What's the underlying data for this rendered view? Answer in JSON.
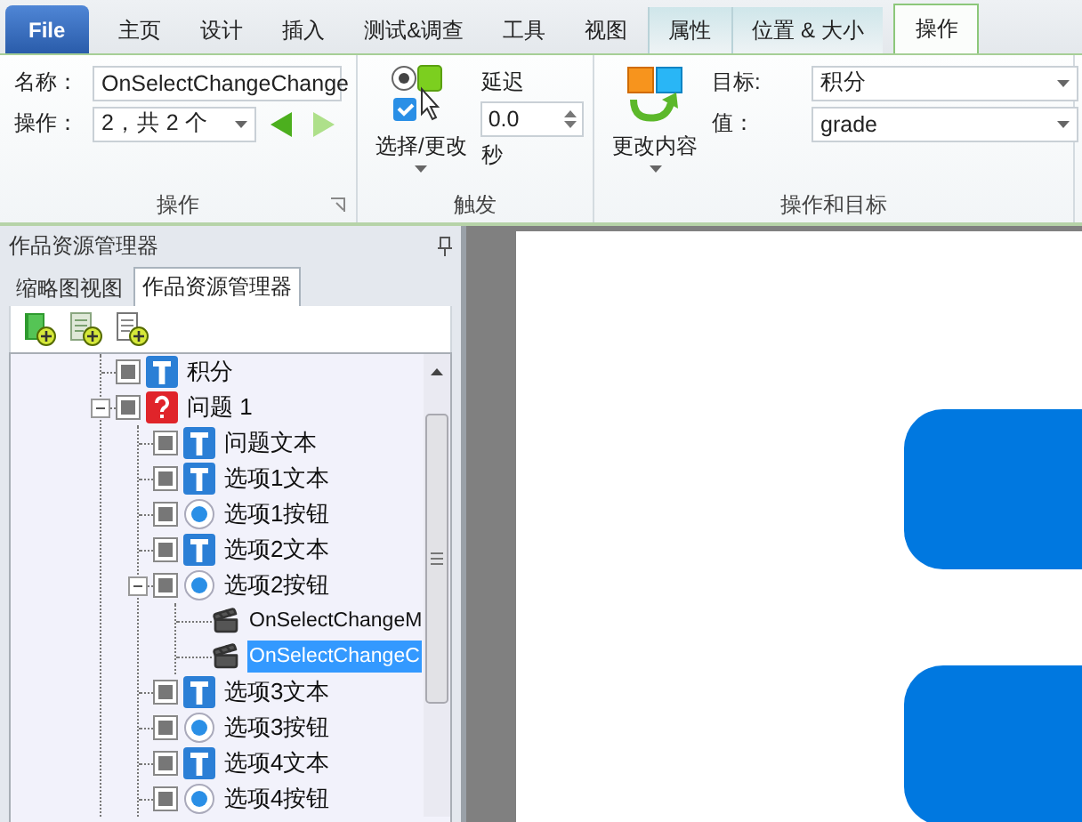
{
  "ribbon_tabs": [
    {
      "label": "File",
      "kind": "file",
      "selected": false
    },
    {
      "label": "主页",
      "kind": "plain",
      "selected": false
    },
    {
      "label": "设计",
      "kind": "plain",
      "selected": false
    },
    {
      "label": "插入",
      "kind": "plain",
      "selected": false
    },
    {
      "label": "测试&调查",
      "kind": "plain",
      "selected": false
    },
    {
      "label": "工具",
      "kind": "plain",
      "selected": false
    },
    {
      "label": "视图",
      "kind": "plain",
      "selected": false
    },
    {
      "label": "属性",
      "kind": "format",
      "selected": false
    },
    {
      "label": "位置 & 大小",
      "kind": "format",
      "selected": false
    },
    {
      "label": "操作",
      "kind": "action",
      "selected": true
    }
  ],
  "action_group": {
    "label": "操作",
    "name_label": "名称：",
    "name_value": "OnSelectChangeChange",
    "step_label": "操作：",
    "step_value": "2，共 2 个",
    "nav": [
      {
        "kind": "prev",
        "disabled": false
      },
      {
        "kind": "next",
        "disabled": true
      }
    ]
  },
  "trigger_group": {
    "label": "触发",
    "button": "选择/更改",
    "delay_label": "延迟",
    "delay_value": "0.0",
    "unit": "秒"
  },
  "target_group": {
    "label": "操作和目标",
    "button": "更改内容",
    "target_label": "目标:",
    "target_value": "积分",
    "value_label": "值：",
    "value_value": "grade"
  },
  "panel": {
    "title": "作品资源管理器",
    "tabs": [
      {
        "label": "缩略图视图",
        "selected": false
      },
      {
        "label": "作品资源管理器",
        "selected": true
      }
    ],
    "tree": [
      {
        "label": "积分",
        "kind": "text",
        "selected": false
      },
      {
        "label": "问题 1",
        "kind": "question",
        "selected": false,
        "expanded": true,
        "children": [
          {
            "label": "问题文本",
            "kind": "text",
            "selected": false
          },
          {
            "label": "选项1文本",
            "kind": "text",
            "selected": false
          },
          {
            "label": "选项1按钮",
            "kind": "radio",
            "selected": false
          },
          {
            "label": "选项2文本",
            "kind": "text",
            "selected": false
          },
          {
            "label": "选项2按钮",
            "kind": "radio",
            "selected": false,
            "expanded": true,
            "children": [
              {
                "label": "OnSelectChangeM",
                "kind": "action",
                "selected": false
              },
              {
                "label": "OnSelectChangeC",
                "kind": "action",
                "selected": true
              }
            ]
          },
          {
            "label": "选项3文本",
            "kind": "text",
            "selected": false
          },
          {
            "label": "选项3按钮",
            "kind": "radio",
            "selected": false
          },
          {
            "label": "选项4文本",
            "kind": "text",
            "selected": false
          },
          {
            "label": "选项4按钮",
            "kind": "radio",
            "selected": false
          }
        ]
      }
    ]
  }
}
